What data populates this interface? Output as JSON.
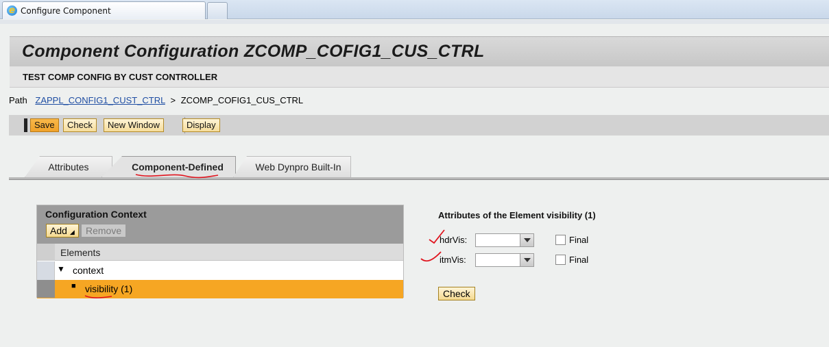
{
  "browser": {
    "tab_title": "Configure Component"
  },
  "header": {
    "title": "Component Configuration ZCOMP_COFIG1_CUS_CTRL",
    "subtitle": "TEST COMP CONFIG BY CUST CONTROLLER"
  },
  "path": {
    "label": "Path",
    "link": "ZAPPL_CONFIG1_CUST_CTRL",
    "separator": ">",
    "current": "ZCOMP_COFIG1_CUS_CTRL"
  },
  "toolbar": {
    "save_label": "Save",
    "check_label": "Check",
    "new_window_label": "New Window",
    "display_label": "Display"
  },
  "tabs": [
    {
      "label": "Attributes",
      "active": false
    },
    {
      "label": "Component-Defined",
      "active": true
    },
    {
      "label": "Web Dynpro Built-In",
      "active": false
    }
  ],
  "context_panel": {
    "title": "Configuration Context",
    "add_label": "Add",
    "remove_label": "Remove",
    "column_header": "Elements",
    "rows": [
      {
        "label": "context",
        "expanded": true,
        "selected": false
      },
      {
        "label": "visibility (1)",
        "selected": true
      }
    ]
  },
  "attributes_form": {
    "title": "Attributes of the Element visibility (1)",
    "fields": [
      {
        "label": "hdrVis:",
        "value": "",
        "final_label": "Final",
        "final_checked": false
      },
      {
        "label": "itmVis:",
        "value": "",
        "final_label": "Final",
        "final_checked": false
      }
    ],
    "check_label": "Check"
  },
  "colors": {
    "accent_orange": "#f6a623",
    "button_yellow": "#f6dd9b",
    "link_blue": "#1f4ea3",
    "annotation_red": "#e0141e"
  }
}
